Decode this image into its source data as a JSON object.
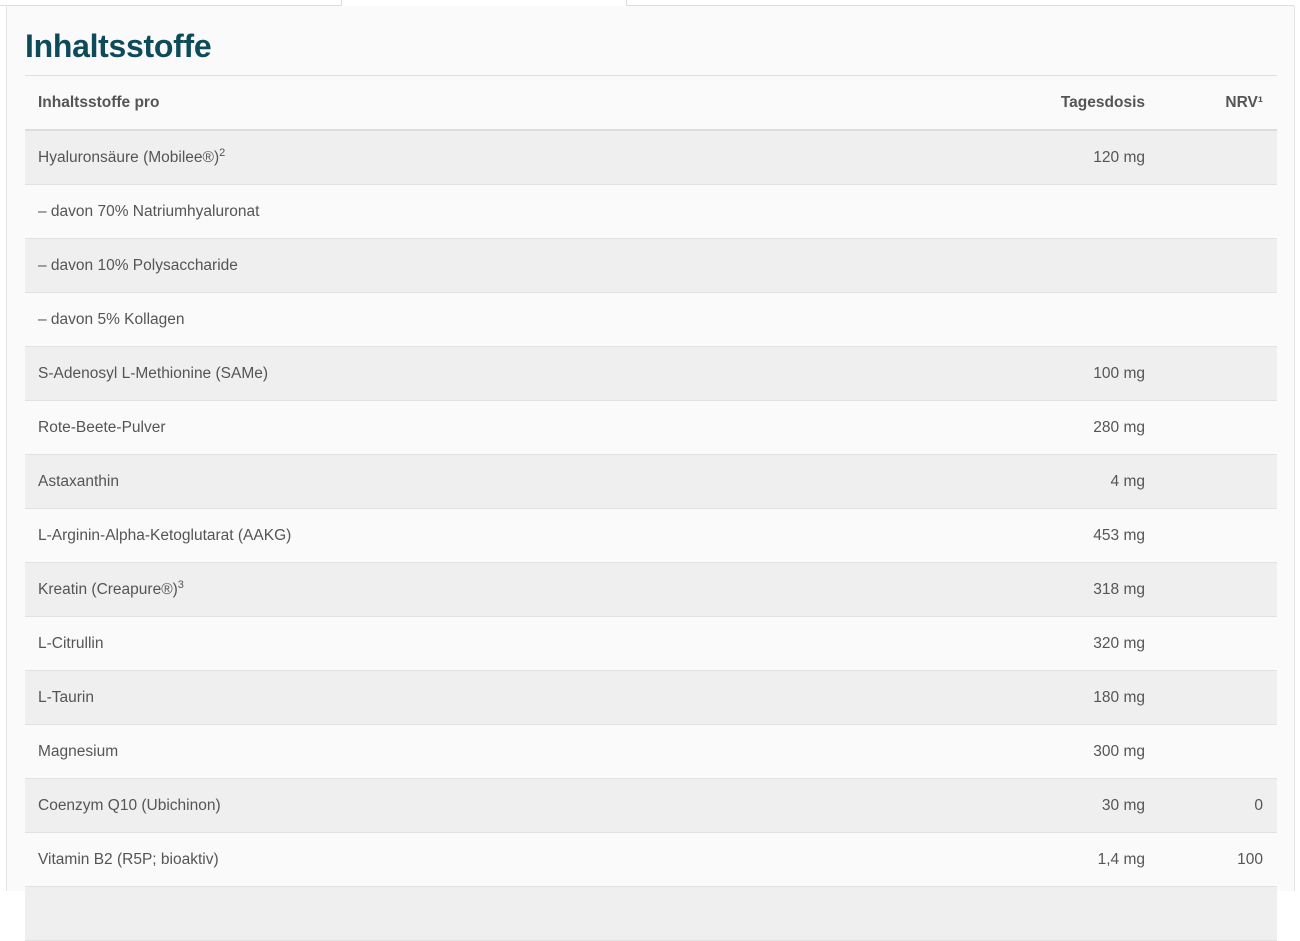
{
  "section": {
    "title": "Inhaltsstoffe"
  },
  "table": {
    "headers": {
      "name": "Inhaltsstoffe pro",
      "dose": "Tagesdosis",
      "nrv": "NRV¹"
    },
    "rows": [
      {
        "name": "Hyaluronsäure (Mobilee®)",
        "sup": "2",
        "dose": "120 mg",
        "nrv": ""
      },
      {
        "name": "– davon 70% Natriumhyaluronat",
        "sup": "",
        "dose": "",
        "nrv": ""
      },
      {
        "name": "– davon 10% Polysaccharide",
        "sup": "",
        "dose": "",
        "nrv": ""
      },
      {
        "name": "– davon 5% Kollagen",
        "sup": "",
        "dose": "",
        "nrv": ""
      },
      {
        "name": "S-Adenosyl L-Methionine (SAMe)",
        "sup": "",
        "dose": "100 mg",
        "nrv": ""
      },
      {
        "name": "Rote-Beete-Pulver",
        "sup": "",
        "dose": "280 mg",
        "nrv": ""
      },
      {
        "name": "Astaxanthin",
        "sup": "",
        "dose": "4 mg",
        "nrv": ""
      },
      {
        "name": "L-Arginin-Alpha-Ketoglutarat (AAKG)",
        "sup": "",
        "dose": "453 mg",
        "nrv": ""
      },
      {
        "name": "Kreatin (Creapure®)",
        "sup": "3",
        "dose": "318 mg",
        "nrv": ""
      },
      {
        "name": "L-Citrullin",
        "sup": "",
        "dose": "320 mg",
        "nrv": ""
      },
      {
        "name": "L-Taurin",
        "sup": "",
        "dose": "180 mg",
        "nrv": ""
      },
      {
        "name": "Magnesium",
        "sup": "",
        "dose": "300 mg",
        "nrv": ""
      },
      {
        "name": "Coenzym Q10 (Ubichinon)",
        "sup": "",
        "dose": "30 mg",
        "nrv": "0"
      },
      {
        "name": "Vitamin B2 (R5P; bioaktiv)",
        "sup": "",
        "dose": "1,4 mg",
        "nrv": "100"
      },
      {
        "name": "",
        "sup": "",
        "dose": "",
        "nrv": ""
      }
    ]
  },
  "colors": {
    "title": "#0e4b5a",
    "text": "#555555",
    "row_stripe": "#efefef",
    "row_plain": "#fafafa"
  }
}
